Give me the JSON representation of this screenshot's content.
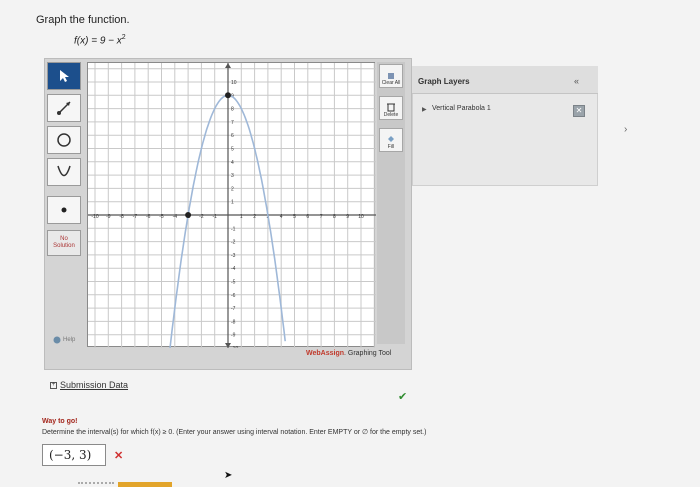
{
  "question": {
    "title": "Graph the function.",
    "function_prefix": "f(x) = 9 − x",
    "function_exp": "2"
  },
  "tools": {
    "items": [
      {
        "name": "pointer-icon",
        "active": true
      },
      {
        "name": "line-icon",
        "active": false
      },
      {
        "name": "circle-icon",
        "active": false
      },
      {
        "name": "parabola-icon",
        "active": false
      },
      {
        "name": "point-icon",
        "active": false
      }
    ],
    "no_solution_line1": "No",
    "no_solution_line2": "Solution",
    "help_label": "Help"
  },
  "graph": {
    "x_ticks": [
      "-10",
      "-9",
      "-8",
      "-7",
      "-6",
      "-5",
      "-4",
      "-3",
      "-2",
      "-1",
      "1",
      "2",
      "3",
      "4",
      "5",
      "6",
      "7",
      "8",
      "9",
      "10"
    ],
    "y_ticks_pos": [
      "10",
      "9",
      "8",
      "7",
      "6",
      "5",
      "4",
      "3",
      "2",
      "1"
    ],
    "y_ticks_neg": [
      "-1",
      "-2",
      "-3",
      "-4",
      "-5",
      "-6",
      "-7",
      "-8",
      "-9",
      "-10"
    ],
    "curve_color": "#9fb8d8",
    "point_color": "#222222",
    "x_range": [
      -10,
      10
    ],
    "y_range": [
      -10,
      10
    ],
    "plotted_points": [
      [
        0,
        9
      ],
      [
        -3,
        0
      ]
    ]
  },
  "right_tools": {
    "clear_all": "Clear All",
    "delete": "Delete",
    "fill": "Fill"
  },
  "brand": {
    "part1": "Web",
    "part2": "Assign",
    "part3": ". Graphing Tool"
  },
  "layers": {
    "title": "Graph Layers",
    "collapse": "«",
    "layer_name": "Vertical Parabola 1",
    "close": "✕"
  },
  "submission": {
    "toggle": "+",
    "label": "Submission Data"
  },
  "feedback": {
    "title": "Way to go!",
    "instruction": "Determine the interval(s) for which f(x) ≥ 0. (Enter your answer using interval notation. Enter EMPTY or ∅ for the empty set.)",
    "answer": "(−3, 3)",
    "wrong_mark": "✕",
    "check_mark": "✔"
  }
}
